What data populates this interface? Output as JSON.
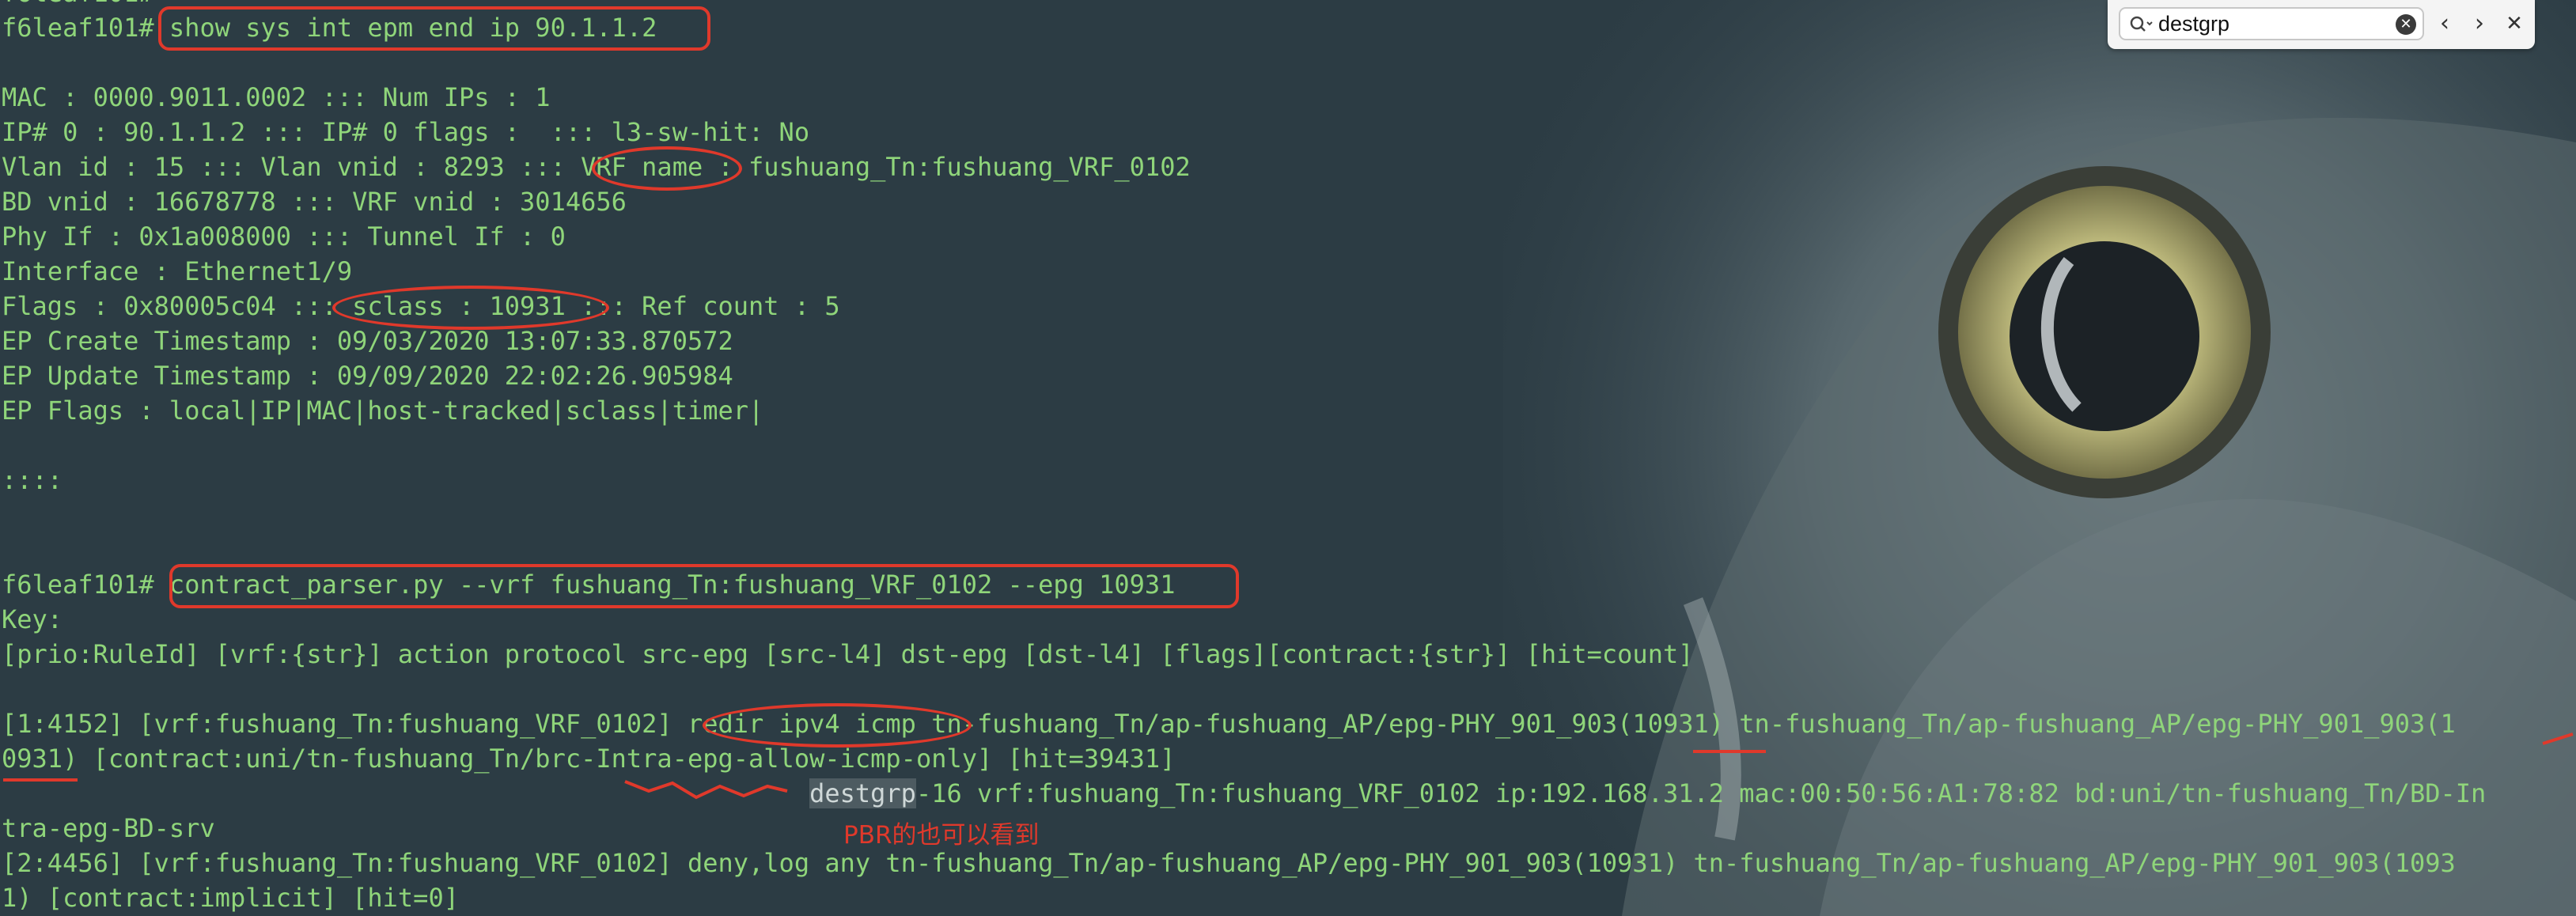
{
  "app": {
    "search_query": "destgrp"
  },
  "terminal": {
    "lines": [
      "f6leaf101# show sys int epm end ip 90.1.1.2",
      "",
      "MAC : 0000.9011.0002 ::: Num IPs : 1",
      "IP# 0 : 90.1.1.2 ::: IP# 0 flags :  ::: l3-sw-hit: No",
      "Vlan id : 15 ::: Vlan vnid : 8293 ::: VRF name : fushuang_Tn:fushuang_VRF_0102",
      "BD vnid : 16678778 ::: VRF vnid : 3014656",
      "Phy If : 0x1a008000 ::: Tunnel If : 0",
      "Interface : Ethernet1/9",
      "Flags : 0x80005c04 ::: sclass : 10931 ::: Ref count : 5",
      "EP Create Timestamp : 09/03/2020 13:07:33.870572",
      "EP Update Timestamp : 09/09/2020 22:02:26.905984",
      "EP Flags : local|IP|MAC|host-tracked|sclass|timer|",
      "",
      "::::",
      "",
      "",
      "f6leaf101# contract_parser.py --vrf fushuang_Tn:fushuang_VRF_0102 --epg 10931",
      "Key:",
      "[prio:RuleId] [vrf:{str}] action protocol src-epg [src-l4] dst-epg [dst-l4] [flags][contract:{str}] [hit=count]",
      "",
      "[1:4152] [vrf:fushuang_Tn:fushuang_VRF_0102] redir ipv4 icmp tn-fushuang_Tn/ap-fushuang_AP/epg-PHY_901_903(10931) tn-fushuang_Tn/ap-fushuang_AP/epg-PHY_901_903(1",
      "0931) [contract:uni/tn-fushuang_Tn/brc-Intra-epg-allow-icmp-only] [hit=39431]",
      "",
      "tra-epg-BD-srv",
      "[2:4456] [vrf:fushuang_Tn:fushuang_VRF_0102] deny,log any tn-fushuang_Tn/ap-fushuang_AP/epg-PHY_901_903(10931) tn-fushuang_Tn/ap-fushuang_AP/epg-PHY_901_903(1093",
      "1) [contract:implicit] [hit=0]"
    ],
    "top_cutoff": "f6leaf101#",
    "pbr_indent": "                                                     ",
    "pbr_match": "destgrp",
    "pbr_rest": "-16 vrf:fushuang_Tn:fushuang_VRF_0102 ip:192.168.31.2 mac:00:50:56:A1:78:82 bd:uni/tn-fushuang_Tn/BD-In"
  },
  "annotation": {
    "note": "PBR的也可以看到"
  },
  "colors": {
    "terminal_text": "#8fd57a",
    "annotation": "#e0392b",
    "background": "#2c3c44"
  }
}
